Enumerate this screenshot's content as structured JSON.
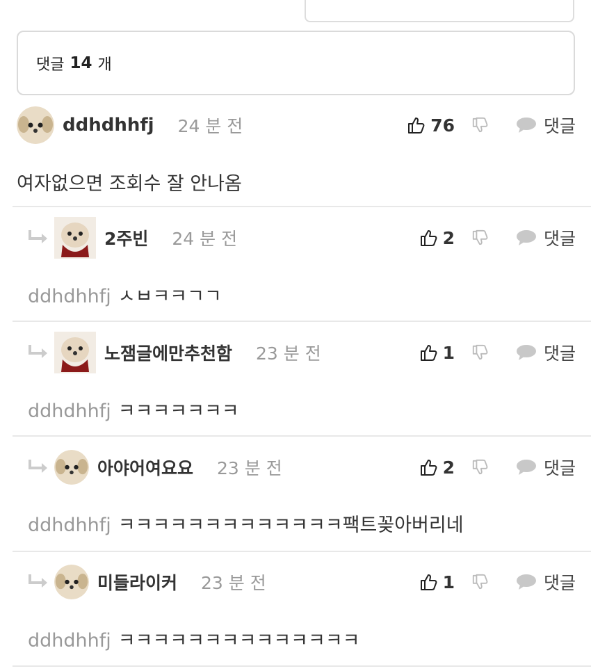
{
  "top_fragment": {
    "colors": {
      "accent": "#c0392b"
    }
  },
  "comment_count": {
    "prefix": "댓글",
    "count": "14",
    "suffix": "개"
  },
  "comments": [
    {
      "nick": "ddhdhhfj",
      "time": "24 분 전",
      "likes": "76",
      "reply_label": "댓글",
      "mention": "",
      "text": "여자없으면 조회수 잘 안나옴",
      "avatar": "dog-avatar"
    },
    {
      "nick": "2주빈",
      "time": "24 분 전",
      "likes": "2",
      "reply_label": "댓글",
      "mention": "ddhdhhfj",
      "text": "ㅅㅂㅋㅋㄱㄱ",
      "avatar": "bloody-dog-avatar"
    },
    {
      "nick": "노잼글에만추천함",
      "time": "23 분 전",
      "likes": "1",
      "reply_label": "댓글",
      "mention": "ddhdhhfj",
      "text": "ㅋㅋㅋㅋㅋㅋㅋ",
      "avatar": "bloody-dog-avatar"
    },
    {
      "nick": "아야어여요요",
      "time": "23 분 전",
      "likes": "2",
      "reply_label": "댓글",
      "mention": "ddhdhhfj",
      "text": "ㅋㅋㅋㅋㅋㅋㅋㅋㅋㅋㅋㅋㅋ팩트꽂아버리네",
      "avatar": "dog-avatar"
    },
    {
      "nick": "미들라이커",
      "time": "23 분 전",
      "likes": "1",
      "reply_label": "댓글",
      "mention": "ddhdhhfj",
      "text": "ㅋㅋㅋㅋㅋㅋㅋㅋㅋㅋㅋㅋㅋㅋ",
      "avatar": "dog-avatar"
    }
  ]
}
